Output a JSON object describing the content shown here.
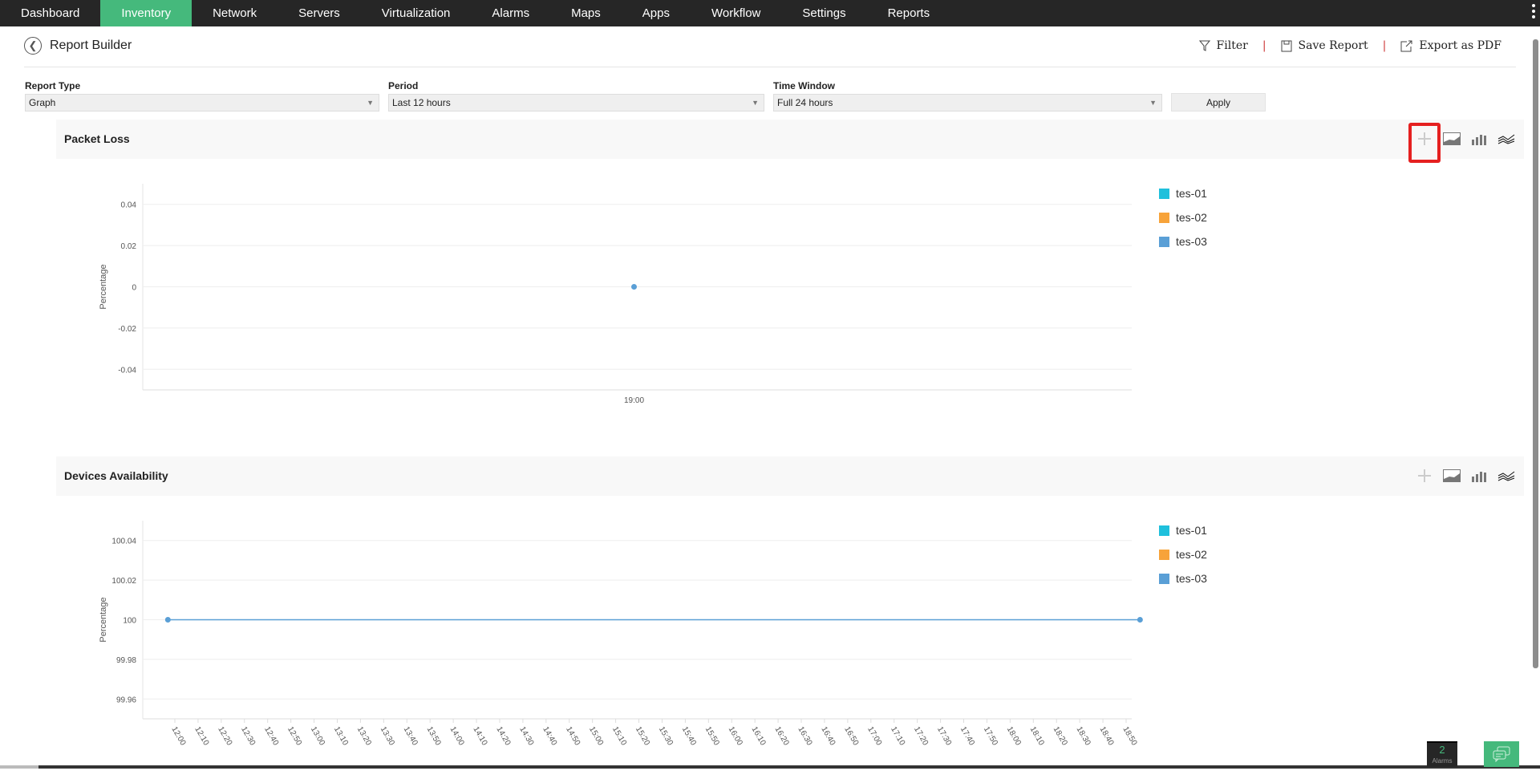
{
  "nav": {
    "tabs": [
      "Dashboard",
      "Inventory",
      "Network",
      "Servers",
      "Virtualization",
      "Alarms",
      "Maps",
      "Apps",
      "Workflow",
      "Settings",
      "Reports"
    ],
    "active": "Inventory"
  },
  "header": {
    "title": "Report Builder",
    "filter": "Filter",
    "save": "Save Report",
    "export": "Export as PDF"
  },
  "form": {
    "report_type_label": "Report Type",
    "report_type": "Graph",
    "period_label": "Period",
    "period": "Last 12 hours",
    "window_label": "Time Window",
    "window": "Full 24 hours",
    "apply": "Apply"
  },
  "legend": [
    {
      "name": "tes-01",
      "color": "#1fc0dc"
    },
    {
      "name": "tes-02",
      "color": "#f7a33a"
    },
    {
      "name": "tes-03",
      "color": "#5a9fd6"
    }
  ],
  "panels": [
    {
      "title": "Packet Loss"
    },
    {
      "title": "Devices Availability"
    }
  ],
  "chart_data": [
    {
      "type": "scatter",
      "title": "Packet Loss",
      "ylabel": "Percentage",
      "ylim": [
        -0.05,
        0.05
      ],
      "yticks": [
        "0.04",
        "0.02",
        "0",
        "-0.02",
        "-0.04"
      ],
      "ytick_values": [
        0.04,
        0.02,
        0,
        -0.02,
        -0.04
      ],
      "xticks": [
        "19:00"
      ],
      "series": [
        {
          "name": "tes-03",
          "points": [
            {
              "x": "19:00",
              "y": 0
            }
          ]
        }
      ],
      "grid": true,
      "legend": "right"
    },
    {
      "type": "line",
      "title": "Devices Availability",
      "ylabel": "Percentage",
      "ylim": [
        99.95,
        100.05
      ],
      "yticks": [
        "100.04",
        "100.02",
        "100",
        "99.98",
        "99.96"
      ],
      "ytick_values": [
        100.04,
        100.02,
        100,
        99.98,
        99.96
      ],
      "xticks": [
        "12:00",
        "12:10",
        "12:20",
        "12:30",
        "12:40",
        "12:50",
        "13:00",
        "13:10",
        "13:20",
        "13:30",
        "13:40",
        "13:50",
        "14:00",
        "14:10",
        "14:20",
        "14:30",
        "14:40",
        "14:50",
        "15:00",
        "15:10",
        "15:20",
        "15:30",
        "15:40",
        "15:50",
        "16:00",
        "16:10",
        "16:20",
        "16:30",
        "16:40",
        "16:50",
        "17:00",
        "17:10",
        "17:20",
        "17:30",
        "17:40",
        "17:50",
        "18:00",
        "18:10",
        "18:20",
        "18:30",
        "18:40",
        "18:50"
      ],
      "series": [
        {
          "name": "tes-03",
          "points": [
            {
              "x": "11:57",
              "y": 100
            },
            {
              "x": "18:56",
              "y": 100
            }
          ]
        }
      ],
      "grid": true,
      "legend": "right"
    }
  ],
  "footer": {
    "alarm_count": "2",
    "alarm_label": "Alarms"
  }
}
